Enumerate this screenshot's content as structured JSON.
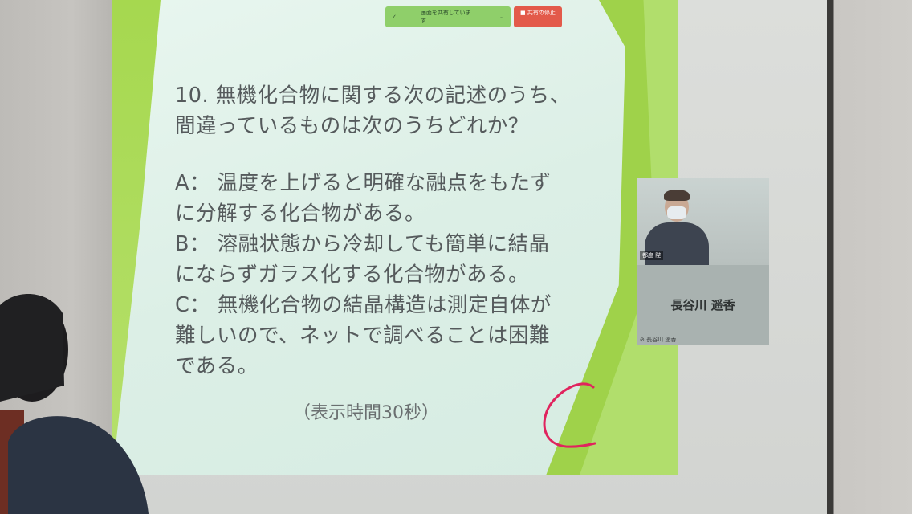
{
  "toolbar": {
    "share_label": "画面を共有しています",
    "stop_label": "共有の停止"
  },
  "slide": {
    "question_line1": "10. 無機化合物に関する次の記述のうち、",
    "question_line2": "間違っているものは次のうちどれか？",
    "a_line1": " A： 温度を上げると明確な融点をもたず",
    "a_line2": "に分解する化合物がある。",
    "b_line1": " B： 溶融状態から冷却しても簡単に結晶",
    "b_line2": "にならずガラス化する化合物がある。",
    "c_line1": " C： 無機化合物の結晶構造は測定自体が",
    "c_line2": "難しいので、ネットで調べることは困難",
    "c_line3": "である。",
    "note": "（表示時間30秒）"
  },
  "participant": {
    "video_label": "都度 陛",
    "name": "長谷川 遥香",
    "small_name": "長谷川 遥香"
  },
  "colors": {
    "accent_green": "#9fd24a",
    "stop_red": "#e35a4a",
    "annotation_red": "#e0245e"
  }
}
